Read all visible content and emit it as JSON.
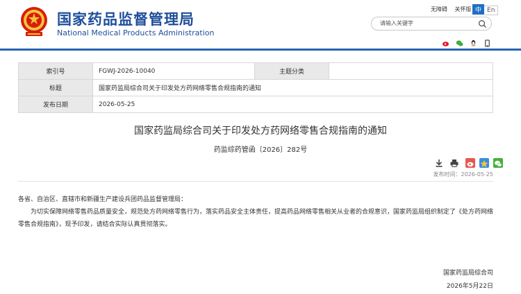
{
  "header": {
    "site_name_cn": "国家药品监督管理局",
    "site_name_en": "National Medical Products Administration",
    "accessibility": "无障碍",
    "care_mode": "关怀版",
    "lang_zh": "中",
    "lang_en": "En",
    "search_placeholder": "请输入关键字",
    "accent_color": "#1f4e9b"
  },
  "info_table": {
    "index_label": "索引号",
    "index_value": "FGWJ-2026-10040",
    "category_label": "主题分类",
    "category_value": "",
    "title_label": "标题",
    "title_value": "国家药监局综合司关于印发处方药网络零售合规指南的通知",
    "date_label": "发布日期",
    "date_value": "2026-05-25"
  },
  "article": {
    "title": "国家药监局综合司关于印发处方药网络零售合规指南的通知",
    "doc_number": "药监综药管函〔2026〕282号",
    "publish_time": "发布时间：2026-05-25",
    "salutation": "各省、自治区、直辖市和新疆生产建设兵团药品监督管理局：",
    "body": "为切实保障网络零售药品质量安全，规范处方药网络零售行为，落实药品安全主体责任，提高药品网络零售相关从业者的合规意识，国家药监局组织制定了《处方药网络零售合规指南》，现予印发，请结合实际认真贯彻落实。",
    "signature": "国家药监局综合司",
    "sign_date": "2026年5月22日"
  },
  "icons": {
    "top_share": [
      "weibo-icon",
      "wechat-icon",
      "qq-icon",
      "mobile-icon"
    ],
    "tools": [
      "download-icon",
      "print-icon",
      "weibo-share-icon",
      "qzone-share-icon",
      "wechat-share-icon"
    ]
  }
}
